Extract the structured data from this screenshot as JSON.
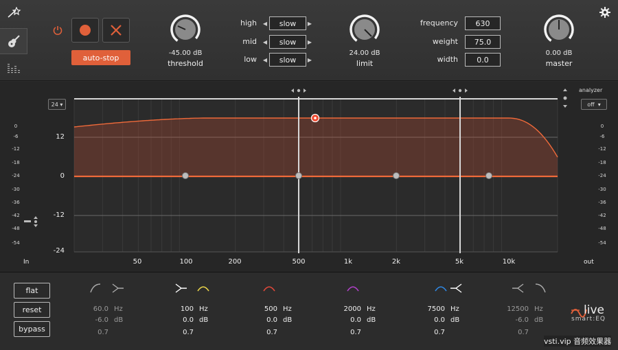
{
  "top": {
    "auto_stop_label": "auto-stop",
    "threshold": {
      "value": "-45.00 dB",
      "label": "threshold"
    },
    "limit": {
      "value": "24.00 dB",
      "label": "limit"
    },
    "master": {
      "value": "0.00 dB",
      "label": "master"
    },
    "speed": [
      {
        "label": "high",
        "value": "slow"
      },
      {
        "label": "mid",
        "value": "slow"
      },
      {
        "label": "low",
        "value": "slow"
      }
    ],
    "fields": [
      {
        "label": "frequency",
        "value": "630"
      },
      {
        "label": "weight",
        "value": "75.0"
      },
      {
        "label": "width",
        "value": "0.0"
      }
    ]
  },
  "graph": {
    "range_select": "24",
    "analyzer_label": "analyzer",
    "analyzer_value": "off",
    "in_label": "In",
    "out_label": "out",
    "left_scale": [
      "0",
      "-6",
      "-12",
      "-18",
      "-24",
      "-30",
      "-36",
      "-42",
      "-48",
      "-54"
    ],
    "right_scale": [
      "0",
      "-6",
      "-12",
      "-18",
      "-24",
      "-30",
      "-36",
      "-42",
      "-48",
      "-54"
    ],
    "gain_ticks": [
      "12",
      "0",
      "-12",
      "-24"
    ],
    "freq_ticks": [
      "50",
      "100",
      "200",
      "500",
      "1k",
      "2k",
      "5k",
      "10k"
    ]
  },
  "bottom": {
    "buttons": [
      "flat",
      "reset",
      "bypass"
    ],
    "bands": [
      {
        "freq": "60.0",
        "gain": "-6.0",
        "q": "0.7",
        "active": false,
        "color": "#cccccc"
      },
      {
        "freq": "100",
        "gain": "0.0",
        "q": "0.7",
        "active": true,
        "color": "#e8d24a"
      },
      {
        "freq": "500",
        "gain": "0.0",
        "q": "0.7",
        "active": true,
        "color": "#e0483a"
      },
      {
        "freq": "2000",
        "gain": "0.0",
        "q": "0.7",
        "active": true,
        "color": "#b040c8"
      },
      {
        "freq": "7500",
        "gain": "0.0",
        "q": "0.7",
        "active": true,
        "color": "#2f86e0"
      },
      {
        "freq": "12500",
        "gain": "-6.0",
        "q": "0.7",
        "active": false,
        "color": "#cccccc"
      }
    ],
    "units": {
      "freq": "Hz",
      "gain": "dB"
    },
    "logo_main": "live",
    "logo_sub": "smart:EQ",
    "watermark": "vsti.vip 音频效果器"
  },
  "colors": {
    "accent": "#e0603a",
    "curve": "#f06a3a"
  }
}
